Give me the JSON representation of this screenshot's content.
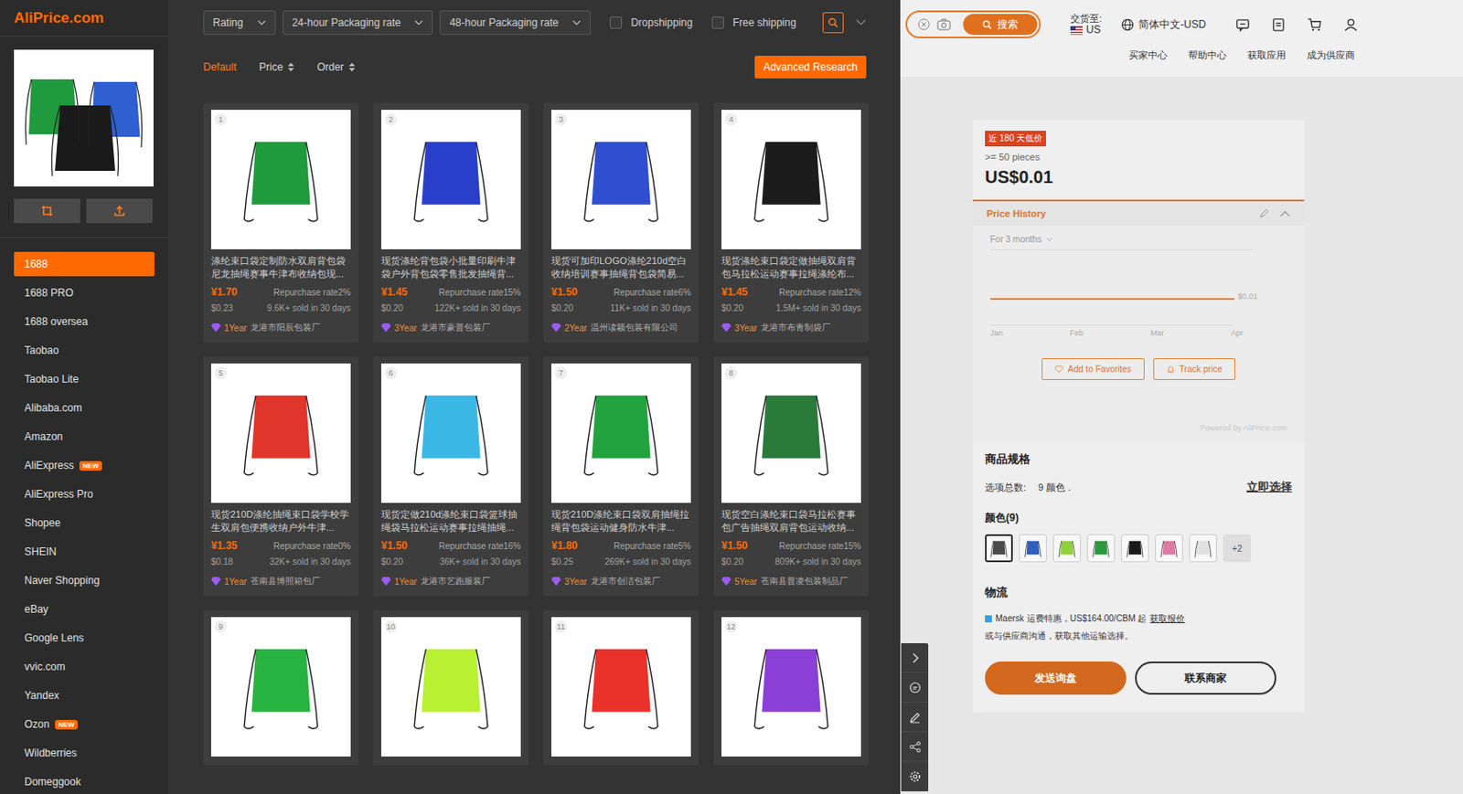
{
  "brand": "AliPrice.com",
  "sidebar": {
    "items": [
      {
        "label": "1688",
        "selected": true
      },
      {
        "label": "1688 PRO",
        "selected": false
      },
      {
        "label": "1688 oversea",
        "selected": false
      },
      {
        "label": "Taobao",
        "selected": false
      },
      {
        "label": "Taobao Lite",
        "selected": false
      },
      {
        "label": "Alibaba.com",
        "selected": false
      },
      {
        "label": "Amazon",
        "selected": false
      },
      {
        "label": "AliExpress",
        "selected": false,
        "badge": "NEW"
      },
      {
        "label": "AliExpress Pro",
        "selected": false
      },
      {
        "label": "Shopee",
        "selected": false
      },
      {
        "label": "SHEIN",
        "selected": false
      },
      {
        "label": "Naver Shopping",
        "selected": false
      },
      {
        "label": "eBay",
        "selected": false
      },
      {
        "label": "Google Lens",
        "selected": false
      },
      {
        "label": "vvic.com",
        "selected": false
      },
      {
        "label": "Yandex",
        "selected": false
      },
      {
        "label": "Ozon",
        "selected": false,
        "badge": "NEW"
      },
      {
        "label": "Wildberries",
        "selected": false
      },
      {
        "label": "Domeggook",
        "selected": false
      }
    ]
  },
  "filters": {
    "dropdowns": [
      "Rating",
      "24-hour Packaging rate",
      "48-hour Packaging rate"
    ],
    "checkboxes": [
      {
        "label": "Dropshipping",
        "checked": false
      },
      {
        "label": "Free shipping",
        "checked": false
      }
    ]
  },
  "sort": [
    {
      "label": "Default",
      "selected": true,
      "arrows": false
    },
    {
      "label": "Price",
      "selected": false,
      "arrows": true
    },
    {
      "label": "Order",
      "selected": false,
      "arrows": true
    }
  ],
  "advanced_button": "Advanced Research",
  "products": [
    {
      "index": "1",
      "color": "#1f9a3c",
      "title": "涤纶束口袋定制防水双肩背包袋尼龙抽绳赛事牛津布收纳包现...",
      "price": "¥1.70",
      "repurchase": "Repurchase rate2%",
      "usd": "$0.23",
      "sold": "9.6K+ sold in 30 days",
      "years": "1Year",
      "shop": "龙港市阳辰包装厂"
    },
    {
      "index": "2",
      "color": "#2a3fc9",
      "title": "现货涤纶背包袋小批量印刷牛津袋户外背包袋零售批发抽绳背...",
      "price": "¥1.45",
      "repurchase": "Repurchase rate15%",
      "usd": "$0.20",
      "sold": "122K+ sold in 30 days",
      "years": "3Year",
      "shop": "龙港市豪普包装厂"
    },
    {
      "index": "3",
      "color": "#2f4fd0",
      "title": "现货可加印LOGO涤纶210d空白收纳培训赛事抽绳背包袋简易...",
      "price": "¥1.50",
      "repurchase": "Repurchase rate6%",
      "usd": "$0.20",
      "sold": "11K+ sold in 30 days",
      "years": "2Year",
      "shop": "温州读颖包装有限公司"
    },
    {
      "index": "4",
      "color": "#1c1c1c",
      "title": "现货涤纶束口袋定做抽绳双肩背包马拉松运动赛事拉绳涤纶布...",
      "price": "¥1.45",
      "repurchase": "Repurchase rate12%",
      "usd": "$0.20",
      "sold": "1.5M+ sold in 30 days",
      "years": "3Year",
      "shop": "龙港市布青制袋厂"
    },
    {
      "index": "5",
      "color": "#e0352b",
      "title": "现货210D涤纶抽绳束口袋学校学生双肩包便携收纳户外牛津...",
      "price": "¥1.35",
      "repurchase": "Repurchase rate0%",
      "usd": "$0.18",
      "sold": "32K+ sold in 30 days",
      "years": "1Year",
      "shop": "苍南县博照箱包厂"
    },
    {
      "index": "6",
      "color": "#3bb7e6",
      "title": "现货定做210d涤纶束口袋篮球抽绳袋马拉松运动赛事拉绳抽绳...",
      "price": "¥1.50",
      "repurchase": "Repurchase rate16%",
      "usd": "$0.20",
      "sold": "36K+ sold in 30 days",
      "years": "1Year",
      "shop": "龙港市艺跑服装厂"
    },
    {
      "index": "7",
      "color": "#22a33f",
      "title": "现货210D涤纶束口袋双肩抽绳拉绳背包袋运动健身防水牛津...",
      "price": "¥1.80",
      "repurchase": "Repurchase rate5%",
      "usd": "$0.25",
      "sold": "269K+ sold in 30 days",
      "years": "3Year",
      "shop": "龙港市创洁包装厂"
    },
    {
      "index": "8",
      "color": "#2a7a3a",
      "title": "现货空白涤纶束口袋马拉松赛事包广告抽绳双肩背包运动收纳...",
      "price": "¥1.50",
      "repurchase": "Repurchase rate15%",
      "usd": "$0.20",
      "sold": "809K+ sold in 30 days",
      "years": "5Year",
      "shop": "苍南县普凌包装制品厂"
    },
    {
      "index": "9",
      "color": "#27b341"
    },
    {
      "index": "10",
      "color": "#b8f032"
    },
    {
      "index": "11",
      "color": "#e8322a"
    },
    {
      "index": "12",
      "color": "#8a3fd6"
    }
  ],
  "page": {
    "topbar": {
      "search_button": "搜索",
      "deliver_label": "交货至:",
      "deliver_country": "US",
      "language": "简体中文-USD",
      "nav": [
        "买家中心",
        "帮助中心",
        "获取应用",
        "成为供应商"
      ]
    },
    "price_card": {
      "badge": "近 180 天低价",
      "min_qty": ">= 50 pieces",
      "price": "US$0.01"
    },
    "price_history": {
      "title": "Price History",
      "range": "For 3 months",
      "series": [
        0.01,
        0.01,
        0.01,
        0.01
      ],
      "value_label": "$0.01",
      "x_ticks": [
        "Jan",
        "Feb",
        "Mar",
        "Apr"
      ],
      "buttons": [
        "Add to Favorites",
        "Track price"
      ],
      "credit": "Powered by AliPrice.com"
    },
    "spec": {
      "title": "商品规格",
      "options_label": "选项总数:",
      "options_value": "9 颜色 .",
      "choose_link": "立即选择",
      "color_title": "颜色(9)",
      "swatches": [
        {
          "color": "#4a4a4a",
          "selected": true
        },
        {
          "color": "#2f5fc0",
          "selected": false
        },
        {
          "color": "#8fd13a",
          "selected": false
        },
        {
          "color": "#2a9a3e",
          "selected": false
        },
        {
          "color": "#1a1a1a",
          "selected": false
        },
        {
          "color": "#e07aa0",
          "selected": false
        },
        {
          "color": "#e0e0e0",
          "selected": false
        }
      ],
      "more": "+2"
    },
    "logistics": {
      "title": "物流",
      "line1": "Maersk 运费特惠，US$164.00/CBM 起",
      "line1_link": "获取报价",
      "line2": "或与供应商沟通，获取其他运输选择。"
    },
    "actions": [
      "发送询盘",
      "联系商家"
    ]
  }
}
